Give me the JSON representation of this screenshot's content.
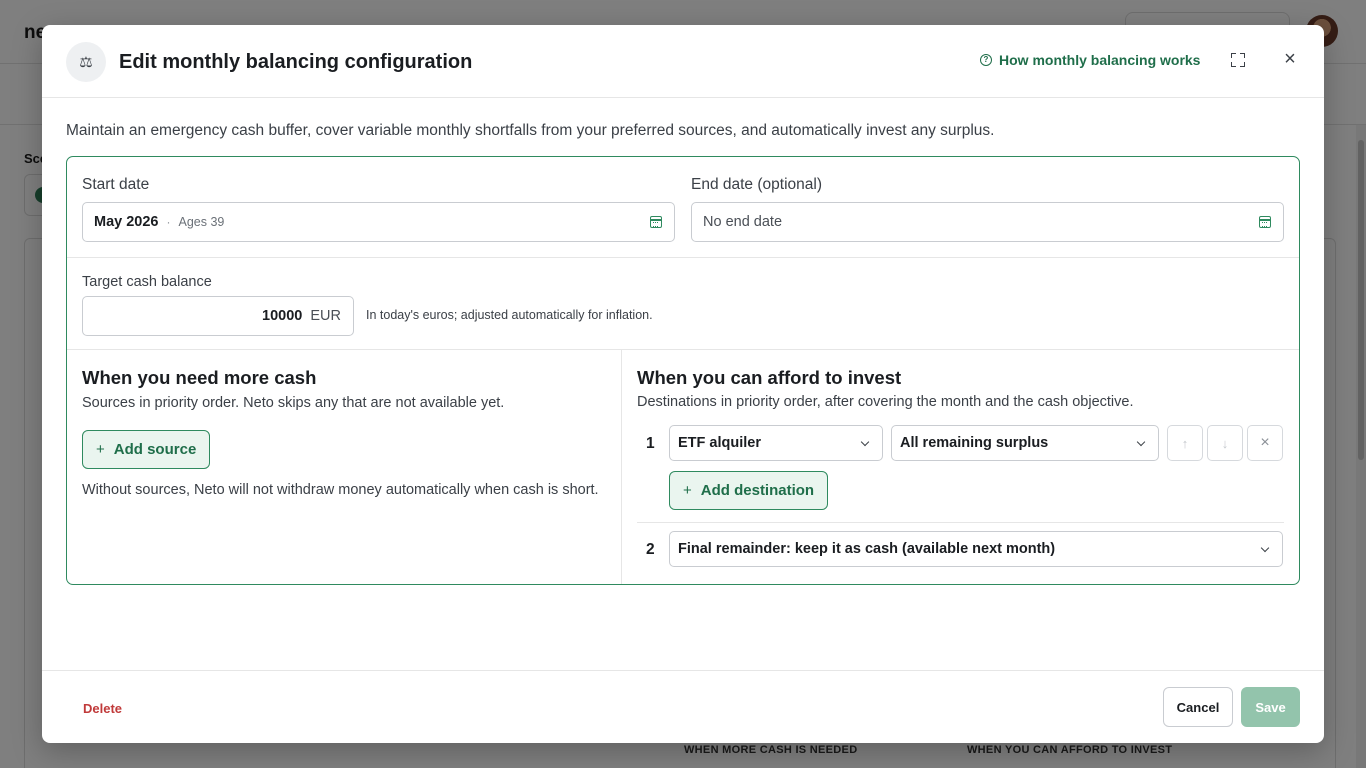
{
  "background": {
    "logo": "ne",
    "section_label": "Sce",
    "column_labels": [
      "WHEN MORE CASH IS NEEDED",
      "WHEN YOU CAN AFFORD TO INVEST"
    ]
  },
  "modal": {
    "title": "Edit monthly balancing configuration",
    "header_icon": "scale-icon",
    "help_link": "How monthly balancing works",
    "description": "Maintain an emergency cash buffer, cover variable monthly shortfalls from your preferred sources, and automatically invest any surplus.",
    "start_date": {
      "label": "Start date",
      "value": "May 2026",
      "separator": "·",
      "ages": "Ages 39"
    },
    "end_date": {
      "label": "End date (optional)",
      "placeholder": "No end date"
    },
    "target_cash": {
      "label": "Target cash balance",
      "value": "10000",
      "currency": "EUR",
      "hint": "In today's euros; adjusted automatically for inflation."
    },
    "sources": {
      "title": "When you need more cash",
      "subtitle": "Sources in priority order. Neto skips any that are not available yet.",
      "add_label": "Add source",
      "note": "Without sources, Neto will not withdraw money automatically when cash is short."
    },
    "destinations": {
      "title": "When you can afford to invest",
      "subtitle": "Destinations in priority order, after covering the month and the cash objective.",
      "items": [
        {
          "num": "1",
          "target": "ETF alquiler",
          "amount": "All remaining surplus"
        },
        {
          "num": "2",
          "target": "Final remainder: keep it as cash (available next month)"
        }
      ],
      "add_label": "Add destination"
    },
    "footer": {
      "delete_label": "Delete",
      "cancel_label": "Cancel",
      "save_label": "Save"
    }
  },
  "colors": {
    "accent": "#2f8a5f",
    "accent_text": "#1f6e4a",
    "danger": "#c03a3a",
    "save_disabled": "#93c4ac"
  }
}
